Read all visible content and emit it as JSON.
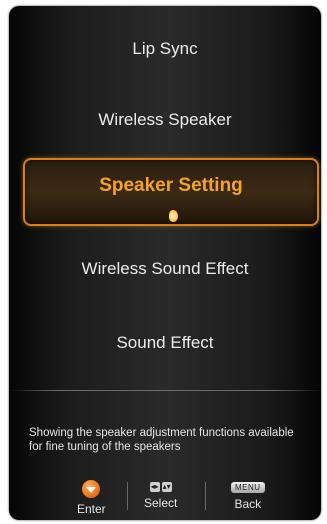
{
  "menu": {
    "items": [
      {
        "label": "Lip Sync"
      },
      {
        "label": "Wireless Speaker"
      },
      {
        "label": "Speaker Setting",
        "selected": true
      },
      {
        "label": "Wireless Sound Effect"
      },
      {
        "label": "Sound Effect"
      }
    ]
  },
  "help_text": "Showing the speaker adjustment functions available for fine tuning of the speakers",
  "controls": {
    "enter": {
      "label": "Enter",
      "icon": "orange-down-arrow-icon"
    },
    "select": {
      "label": "Select",
      "icon": "left-right-arrow-keys-icon",
      "glyphs": [
        "◂▸",
        "▴▾"
      ]
    },
    "back": {
      "label": "Back",
      "icon": "menu-key-icon",
      "key_text": "MENU"
    }
  },
  "colors": {
    "selected_text": "#f3a32c",
    "selected_border": "#d87f1a",
    "normal_text": "#ececec",
    "panel_bg": "#1b1b1b"
  }
}
